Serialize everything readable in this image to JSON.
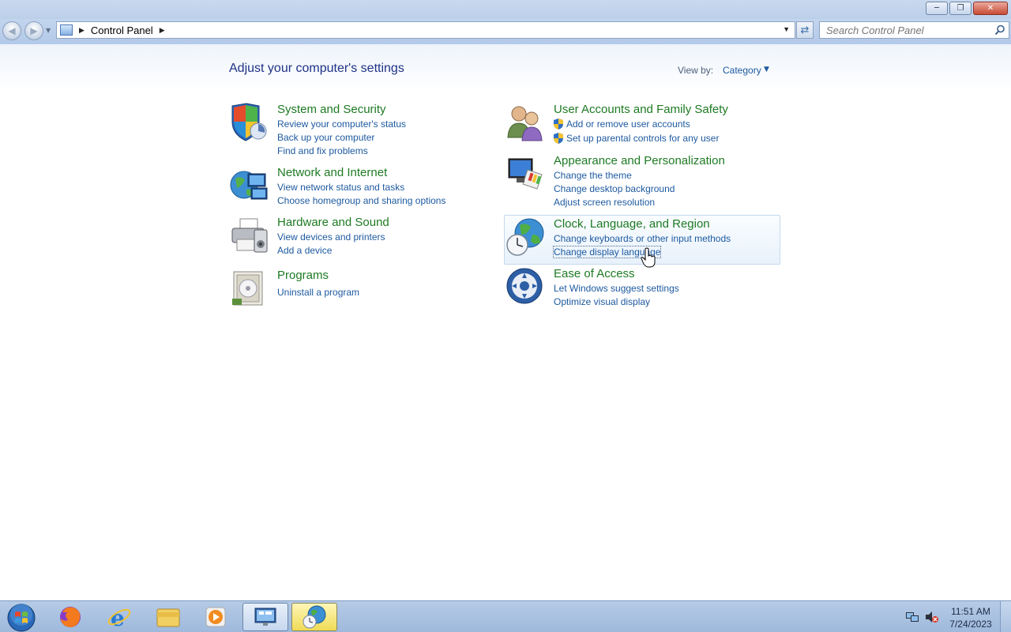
{
  "window": {
    "controls": {
      "minimize_icon": "minimize-icon",
      "maximize_icon": "restore-icon",
      "close_icon": "close-icon",
      "close_color": "#c84a34"
    }
  },
  "navigation": {
    "back_icon": "back-arrow-icon",
    "forward_icon": "forward-arrow-icon",
    "address": {
      "root_icon": "control-panel-icon",
      "crumb": "Control Panel"
    },
    "refresh_icon": "refresh-icon",
    "search": {
      "placeholder": "Search Control Panel",
      "icon": "search-icon"
    }
  },
  "content": {
    "title": "Adjust your computer's settings",
    "view_by": {
      "label": "View by:",
      "value": "Category"
    },
    "categories": [
      {
        "title": "System and Security",
        "icon": "shield-icon",
        "links": [
          "Review your computer's status",
          "Back up your computer",
          "Find and fix problems"
        ]
      },
      {
        "title": "Network and Internet",
        "icon": "network-globe-icon",
        "links": [
          "View network status and tasks",
          "Choose homegroup and sharing options"
        ]
      },
      {
        "title": "Hardware and Sound",
        "icon": "printer-icon",
        "links": [
          "View devices and printers",
          "Add a device"
        ]
      },
      {
        "title": "Programs",
        "icon": "programs-icon",
        "links": [
          "Uninstall a program"
        ]
      },
      {
        "title": "User Accounts and Family Safety",
        "icon": "users-icon",
        "links": [
          "Add or remove user accounts",
          "Set up parental controls for any user"
        ]
      },
      {
        "title": "Appearance and Personalization",
        "icon": "monitor-palette-icon",
        "links": [
          "Change the theme",
          "Change desktop background",
          "Adjust screen resolution"
        ]
      },
      {
        "title": "Clock, Language, and Region",
        "icon": "globe-clock-icon",
        "links": [
          "Change keyboards or other input methods",
          "Change display language"
        ]
      },
      {
        "title": "Ease of Access",
        "icon": "ease-of-access-icon",
        "links": [
          "Let Windows suggest settings",
          "Optimize visual display"
        ]
      }
    ]
  },
  "taskbar": {
    "start_icon": "windows-start-icon",
    "items": [
      "firefox-icon",
      "internet-explorer-icon",
      "file-explorer-icon",
      "media-player-icon",
      "control-panel-icon",
      "clock-language-region-icon"
    ],
    "tray": {
      "network_icon": "network-icon",
      "volume_icon": "volume-muted-icon",
      "time": "11:51 AM",
      "date": "7/24/2023"
    }
  },
  "colors": {
    "link": "#1e5aa0",
    "category_title": "#1e7a23",
    "page_title": "#1e3287"
  }
}
